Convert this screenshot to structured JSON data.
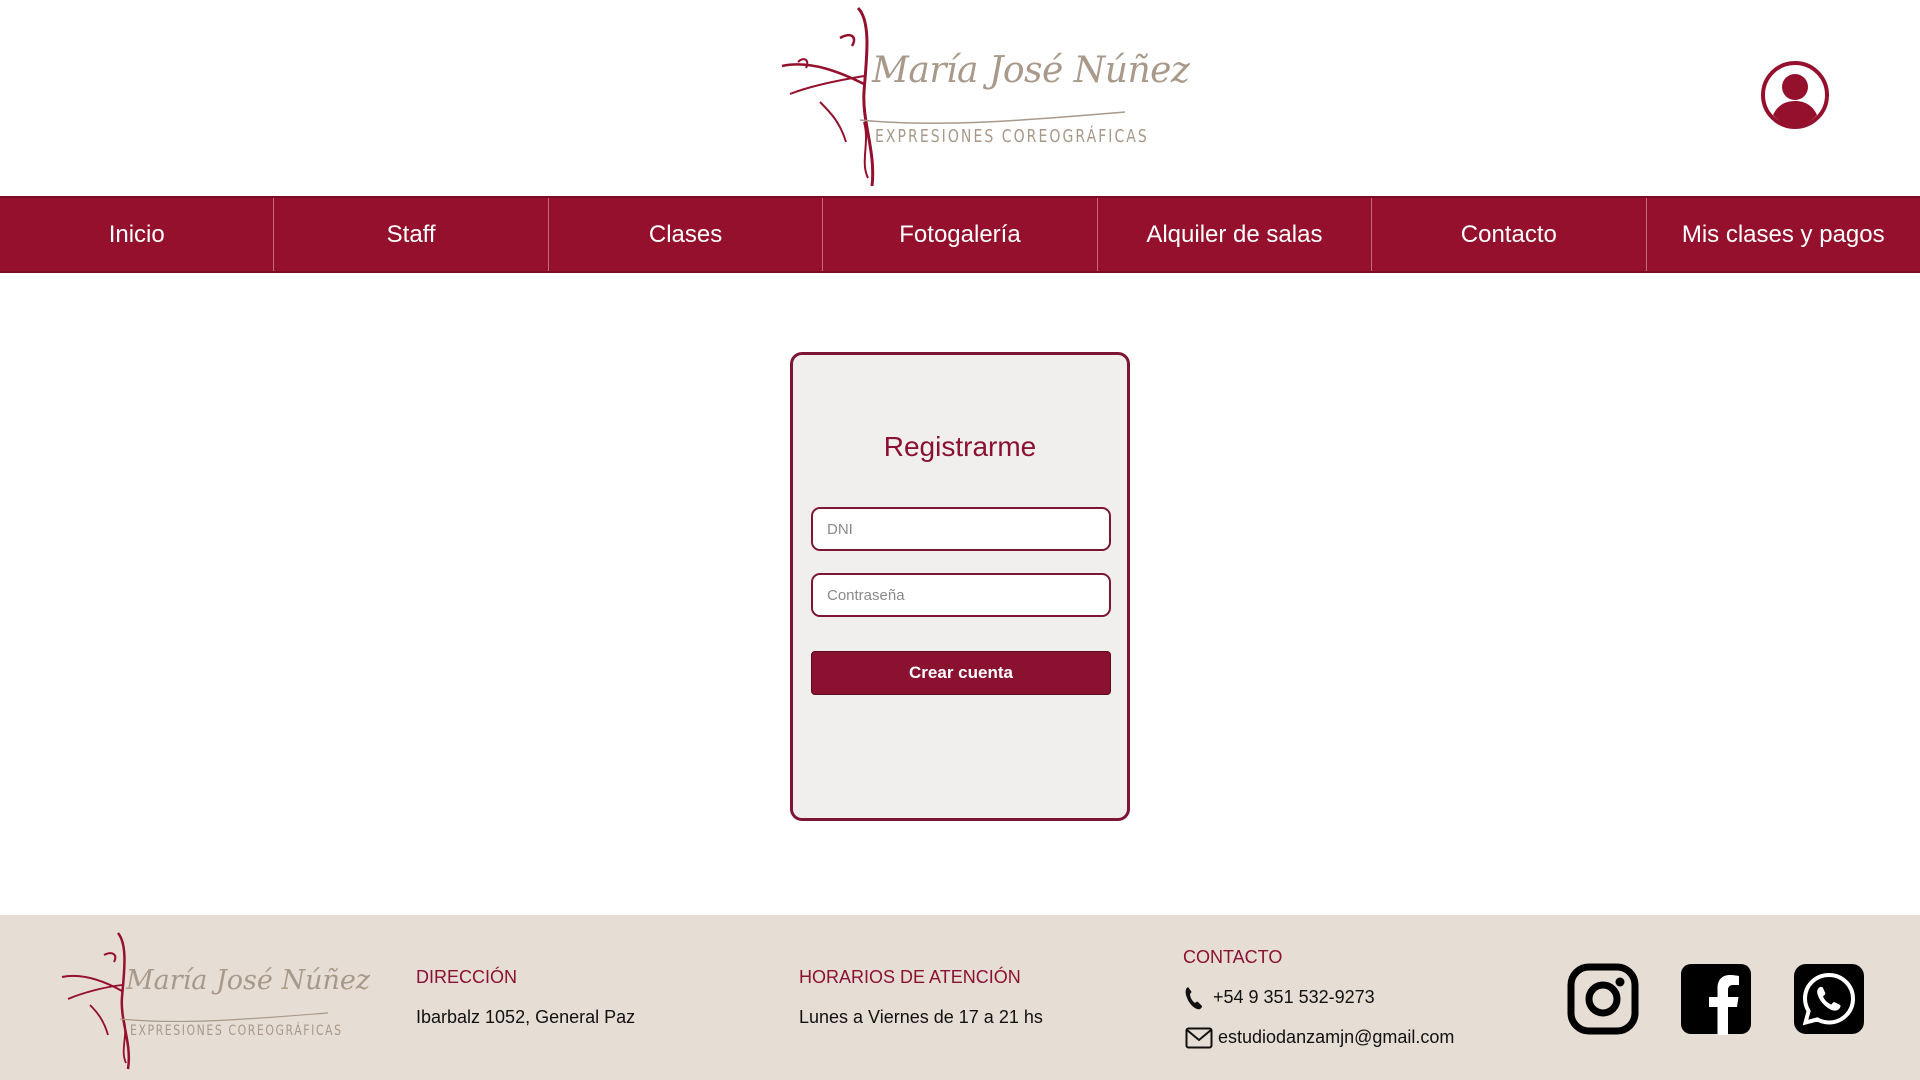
{
  "brand": {
    "name_script": "María José Núñez",
    "tagline": "EXPRESIONES COREOGRÁFICAS",
    "color_primary": "#94102d",
    "color_text_gold": "#a8998a",
    "color_footer_bg": "#e6ddd5",
    "color_card_bg": "#f1efed"
  },
  "header": {
    "user_icon": "user-account-icon"
  },
  "nav": {
    "items": [
      {
        "label": "Inicio"
      },
      {
        "label": "Staff"
      },
      {
        "label": "Clases"
      },
      {
        "label": "Fotogalería"
      },
      {
        "label": "Alquiler de salas"
      },
      {
        "label": "Contacto"
      },
      {
        "label": "Mis clases y pagos"
      }
    ]
  },
  "register": {
    "title": "Registrarme",
    "dni_placeholder": "DNI",
    "dni_value": "",
    "password_placeholder": "Contraseña",
    "password_value": "",
    "submit_label": "Crear cuenta"
  },
  "footer": {
    "address": {
      "heading": "DIRECCIÓN",
      "text": "Ibarbalz 1052, General Paz"
    },
    "hours": {
      "heading": "HORARIOS DE ATENCIÓN",
      "text": "Lunes a Viernes de 17 a 21 hs"
    },
    "contact": {
      "heading": "CONTACTO",
      "phone": "+54 9 351 532-9273",
      "phone_icon": "phone-icon",
      "email": "estudiodanzamjn@gmail.com",
      "email_icon": "mail-icon"
    },
    "social": [
      {
        "icon": "instagram-icon"
      },
      {
        "icon": "facebook-icon"
      },
      {
        "icon": "whatsapp-icon"
      }
    ]
  }
}
